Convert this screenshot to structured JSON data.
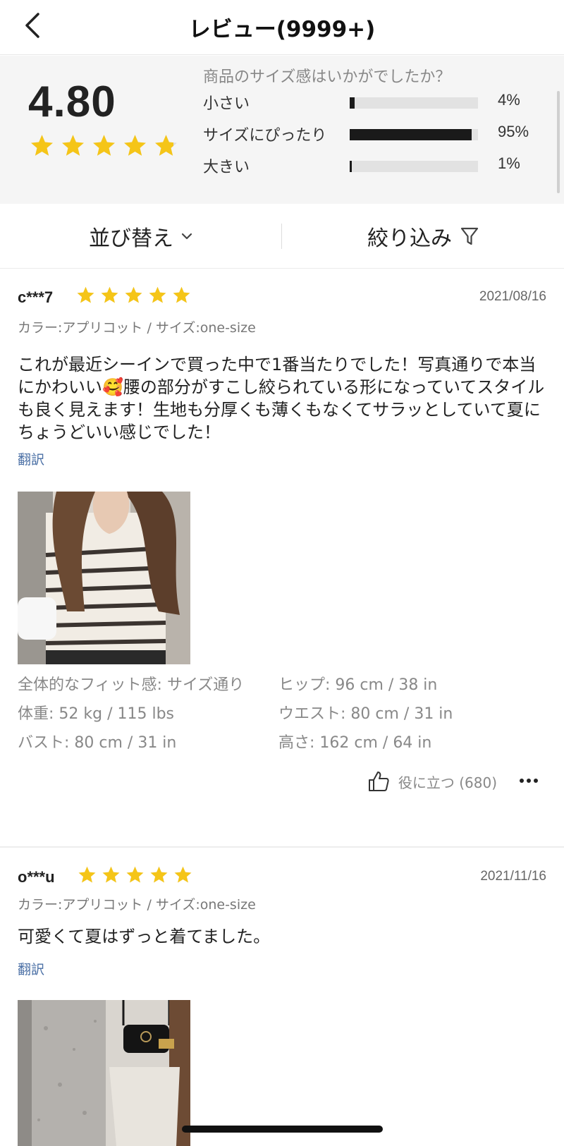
{
  "header": {
    "title": "レビュー(9999+)",
    "back_icon": "chevron-left-icon"
  },
  "summary": {
    "rating": "4.80",
    "rating_value": 4.8,
    "fit_question": "商品のサイズ感はいかがでしたか？",
    "fit": [
      {
        "label": "小さい",
        "percent": "4%",
        "value": 0.04
      },
      {
        "label": "サイズにぴったり",
        "percent": "95%",
        "value": 0.95
      },
      {
        "label": "大きい",
        "percent": "1%",
        "value": 0.01
      }
    ]
  },
  "toolbar": {
    "sort_label": "並び替え",
    "filter_label": "絞り込み",
    "sort_icon": "chevron-down-icon",
    "filter_icon": "filter-icon"
  },
  "colors": {
    "star": "#F5C518",
    "bar_fill": "#1a1a1a",
    "bar_track": "#e2e2e2",
    "link": "#4a6fa5"
  },
  "reviews": [
    {
      "user": "c***7",
      "stars": 5,
      "date": "2021/08/16",
      "attrs": "カラー:アプリコット / サイズ:one-size",
      "text": "これが最近シーインで買った中で1番当たりでした！写真通りで本当にかわいい🥰腰の部分がすこし絞られている形になっていてスタイルも良く見えます！生地も分厚くも薄くもなくてサラッとしていて夏にちょうどいい感じでした！",
      "translate": "翻訳",
      "measurements": {
        "fit": "全体的なフィット感: サイズ通り",
        "weight": "体重: 52 kg / 115 lbs",
        "bust": "バスト: 80 cm / 31 in",
        "hip": "ヒップ: 96 cm / 38 in",
        "waist": "ウエスト: 80 cm / 31 in",
        "height": "高さ: 162 cm / 64 in"
      },
      "helpful": "役に立つ (680)"
    },
    {
      "user": "o***u",
      "stars": 5,
      "date": "2021/11/16",
      "attrs": "カラー:アプリコット / サイズ:one-size",
      "text": "可愛くて夏はずっと着てました。",
      "translate": "翻訳"
    }
  ]
}
